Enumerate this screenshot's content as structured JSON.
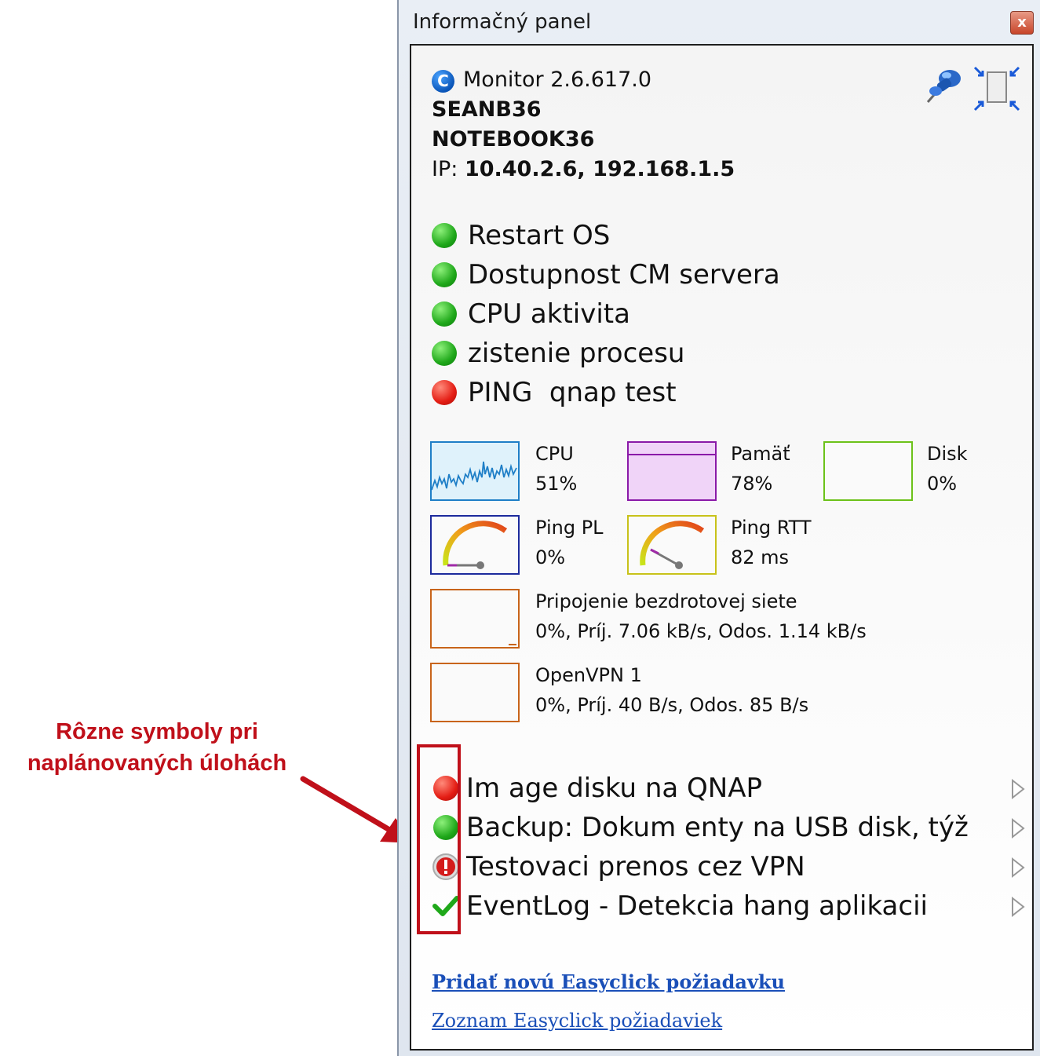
{
  "annotation": {
    "line1": "Rôzne symboly pri",
    "line2": "naplánovaných úlohách",
    "color": "#c0101a"
  },
  "window": {
    "title": "Informačný panel",
    "close_label": "x"
  },
  "header": {
    "app_name": "Monitor 2.6.617.0",
    "user": "SEANB36",
    "computer": "NOTEBOOK36",
    "ip_label": "IP:",
    "ip_value": "10.40.2.6, 192.168.1.5",
    "icons": [
      "monitor-icon",
      "pin-icon",
      "shrink-window-icon"
    ]
  },
  "statuses": [
    {
      "label": "Restart OS",
      "state": "ok"
    },
    {
      "label": "Dostupnost CM servera",
      "state": "ok"
    },
    {
      "label": "CPU aktivita",
      "state": "ok"
    },
    {
      "label": "zistenie procesu",
      "state": "ok"
    },
    {
      "label": "PING  qnap test",
      "state": "error"
    }
  ],
  "performance": {
    "cpu": {
      "name": "CPU",
      "value": "51%",
      "color": "#1f7fc7",
      "percent": 51
    },
    "memory": {
      "name": "Pamäť",
      "value": "78%",
      "color": "#8a1aa8",
      "percent": 78
    },
    "disk": {
      "name": "Disk",
      "value": "0%",
      "color": "#6cc21a",
      "percent": 0
    },
    "ping_pl": {
      "name": "Ping PL",
      "value": "0%",
      "color": "#1c2a9c"
    },
    "ping_rtt": {
      "name": "Ping RTT",
      "value": "82 ms",
      "color": "#c8c21a"
    },
    "wifi": {
      "name": "Pripojenie bezdrotovej siete",
      "value": "0%, Príj. 7.06 kB/s, Odos. 1.14 kB/s",
      "color": "#c8641a"
    },
    "vpn": {
      "name": "OpenVPN 1",
      "value": "0%, Príj. 40 B/s, Odos. 85 B/s",
      "color": "#c8641a"
    }
  },
  "tasks": [
    {
      "label": "Im age disku na QNAP",
      "icon": "red-dot-icon"
    },
    {
      "label": "Backup: Dokum enty na USB disk, týždenne",
      "icon": "green-dot-icon"
    },
    {
      "label": "Testovaci prenos cez VPN",
      "icon": "warning-icon"
    },
    {
      "label": "EventLog - Detekcia hang aplikacii",
      "icon": "checkmark-icon"
    }
  ],
  "links": {
    "add_request": "Pridať novú Easyclick požiadavku",
    "list_requests": "Zoznam Easyclick požiadaviek"
  }
}
